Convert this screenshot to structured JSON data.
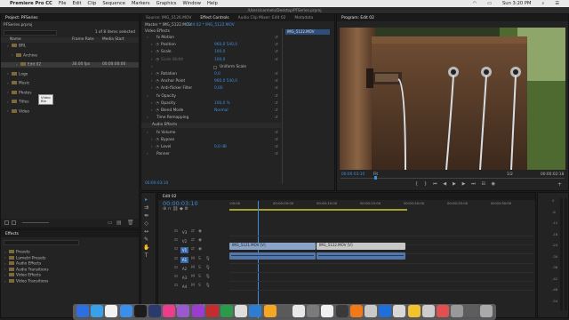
{
  "menubar": {
    "app": "Premiere Pro CC",
    "items": [
      "File",
      "Edit",
      "Clip",
      "Sequence",
      "Markers",
      "Graphics",
      "Window",
      "Help"
    ],
    "clock": "Sun 3:20 PM"
  },
  "path": "/Users/carmelo/Desktop/PFSeries.prproj",
  "project": {
    "tab": "Project: PFSeries",
    "file": "PFSeries.prproj",
    "selection": "1 of 8 items selected",
    "columns": [
      "Name",
      "Frame Rate",
      "Media Start",
      "Media End"
    ],
    "items": [
      {
        "name": "BRL",
        "indent": 1
      },
      {
        "name": "Archive",
        "indent": 2
      },
      {
        "name": "Edit 02",
        "indent": 3,
        "fps": "30.00 fps",
        "start": "00:00:00:00",
        "end": "00:00:02:18",
        "selected": true
      },
      {
        "name": "Logo",
        "indent": 1
      },
      {
        "name": "Music",
        "indent": 1
      },
      {
        "name": "Photos",
        "indent": 1
      },
      {
        "name": "Titles",
        "indent": 1
      },
      {
        "name": "Video",
        "indent": 1
      }
    ],
    "tooltip": [
      "Video",
      "Bin"
    ]
  },
  "effects": {
    "tab": "Effects",
    "items": [
      "Presets",
      "Lumetri Presets",
      "Audio Effects",
      "Audio Transitions",
      "Video Effects",
      "Video Transitions"
    ]
  },
  "effect_controls": {
    "tabs": [
      "Source: IMG_5126.MOV",
      "Effect Controls",
      "Audio Clip Mixer: Edit 02",
      "Metadata"
    ],
    "active_tab": 1,
    "master": "Master * IMG_5122.MOV",
    "seq": "Edit 02 * IMG_5122.MOV",
    "clip_label": "IMG_5122.MOV",
    "video_effects": "Video Effects",
    "rows": [
      {
        "label": "fx  Motion",
        "value": "",
        "level": 1
      },
      {
        "label": "Position",
        "value": "960,0     540,0",
        "level": 2
      },
      {
        "label": "Scale",
        "value": "100,0",
        "level": 2
      },
      {
        "label": "Scale Width",
        "value": "100,0",
        "level": 2,
        "dim": true
      },
      {
        "label": "",
        "value": "Uniform Scale",
        "level": 2,
        "check": true
      },
      {
        "label": "Rotation",
        "value": "0,0",
        "level": 2
      },
      {
        "label": "Anchor Point",
        "value": "960,0     540,0",
        "level": 2
      },
      {
        "label": "Anti-flicker Filter",
        "value": "0,00",
        "level": 2
      },
      {
        "label": "fx  Opacity",
        "value": "",
        "level": 1
      },
      {
        "label": "Opacity",
        "value": "100,0 %",
        "level": 2
      },
      {
        "label": "Blend Mode",
        "value": "Normal",
        "level": 2
      },
      {
        "label": "Time Remapping",
        "value": "",
        "level": 1
      },
      {
        "label": "Audio Effects",
        "value": "",
        "level": 0
      },
      {
        "label": "fx  Volume",
        "value": "",
        "level": 1
      },
      {
        "label": "Bypass",
        "value": "",
        "level": 2
      },
      {
        "label": "Level",
        "value": "0,0 dB",
        "level": 2
      },
      {
        "label": "Panner",
        "value": "",
        "level": 1
      }
    ],
    "timecode": "00:00:03:10"
  },
  "program": {
    "tab": "Program: Edit 02",
    "timecode": "00:00:03:10",
    "fit": "Fit",
    "fraction": "1/2",
    "duration": "00:00:02:18"
  },
  "timeline": {
    "tab": "Edit 02",
    "timecode": "00:00:03:10",
    "ruler": [
      ":00:00",
      "00:00:05:00",
      "00:00:10:00",
      "00:00:15:00",
      "00:00:20:00",
      "00:00:25:00",
      "00:00:30:00"
    ],
    "tracks_video": [
      "V3",
      "V2",
      "V1"
    ],
    "tracks_audio": [
      "A1",
      "A2",
      "A3",
      "A4"
    ],
    "master": "Master",
    "master_val": "0,0",
    "clips": [
      {
        "track": "V1",
        "label": "IMG_5121.MOV [V]",
        "kind": "video"
      },
      {
        "track": "V1",
        "label": "IMG_5122.MOV [V]",
        "kind": "video2"
      },
      {
        "track": "A1",
        "label": "",
        "kind": "audio"
      },
      {
        "track": "A1",
        "label": "",
        "kind": "audio"
      }
    ]
  },
  "meter_labels": [
    "0",
    "-6",
    "-12",
    "-18",
    "-24",
    "-30",
    "-36",
    "-42",
    "-48",
    "-54"
  ],
  "colors": {
    "accent": "#3b8fe0",
    "video_clip": "#8aa3c9",
    "audio_clip": "#5577a8",
    "video_clip2": "#c8c8c8"
  }
}
